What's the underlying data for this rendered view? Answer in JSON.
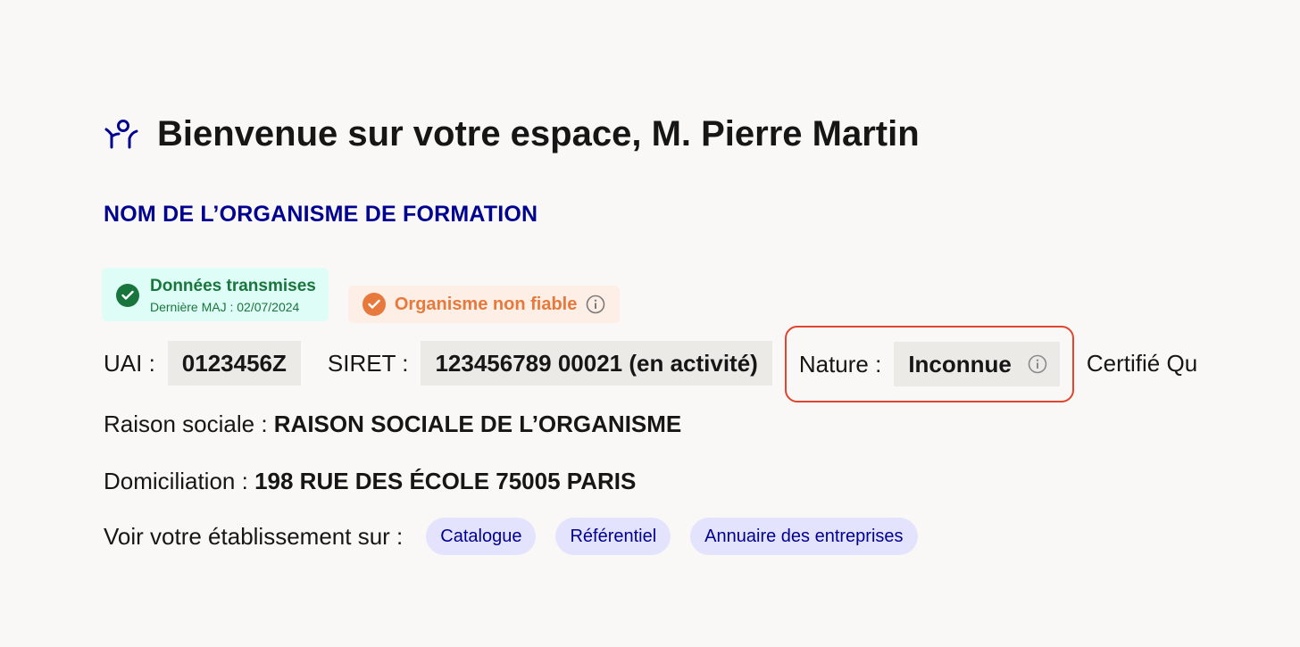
{
  "welcome": {
    "icon": "person-icon",
    "title": "Bienvenue sur votre espace, M. Pierre Martin"
  },
  "organisme": {
    "name": "NOM DE L’ORGANISME DE FORMATION"
  },
  "badges": {
    "transmitted": {
      "label": "Données transmises",
      "sub": "Dernière MAJ : 02/07/2024",
      "color": "#18753c",
      "icon": "check-circle-icon"
    },
    "reliability": {
      "label": "Organisme non fiable",
      "color": "#e8793c",
      "icon": "check-circle-icon",
      "info_icon": "info-icon"
    }
  },
  "identifiers": {
    "uai_label": "UAI :",
    "uai_value": "0123456Z",
    "siret_label": "SIRET :",
    "siret_value": "123456789 00021 (en activité)",
    "nature_label": "Nature :",
    "nature_value": "Inconnue",
    "certif_label": "Certifié Qu"
  },
  "raison": {
    "label": "Raison sociale :",
    "value": "RAISON SOCIALE DE L’ORGANISME"
  },
  "domiciliation": {
    "label": "Domiciliation :",
    "value": "198 RUE DES ÉCOLE 75005 PARIS"
  },
  "links": {
    "label": "Voir votre établissement sur :",
    "items": [
      "Catalogue",
      "Référentiel",
      "Annuaire des entreprises"
    ]
  },
  "colors": {
    "accent": "#000091",
    "highlight_border": "#e0452f",
    "background": "#f9f8f6"
  }
}
